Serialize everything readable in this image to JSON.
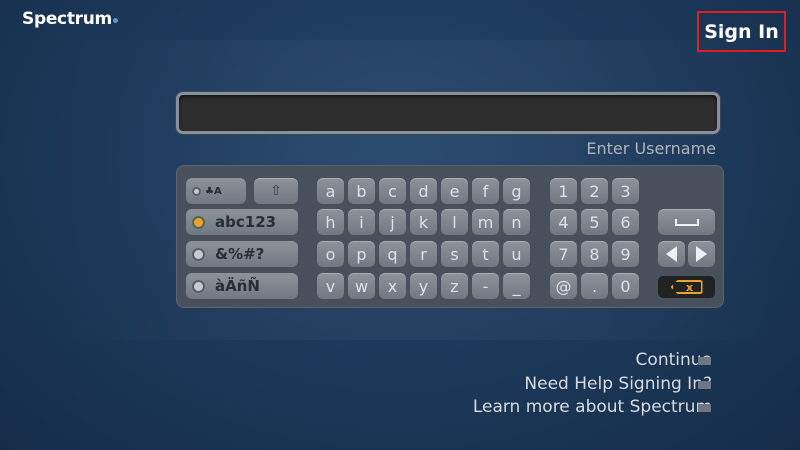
{
  "header": {
    "brand": "Spectrum",
    "signin_label": "Sign In"
  },
  "form": {
    "username_value": "",
    "username_label": "Enter Username"
  },
  "keyboard": {
    "modes": [
      {
        "label": "♣A",
        "selected": false
      },
      {
        "label": "abc123",
        "selected": true
      },
      {
        "label": "&%#?",
        "selected": false
      },
      {
        "label": "àÄñÑ",
        "selected": false
      }
    ],
    "shift_label": "⇧",
    "letter_rows": [
      [
        "a",
        "b",
        "c",
        "d",
        "e",
        "f",
        "g"
      ],
      [
        "h",
        "i",
        "j",
        "k",
        "l",
        "m",
        "n"
      ],
      [
        "o",
        "p",
        "q",
        "r",
        "s",
        "t",
        "u"
      ],
      [
        "v",
        "w",
        "x",
        "y",
        "z",
        "-",
        "_"
      ]
    ],
    "number_rows": [
      [
        "1",
        "2",
        "3"
      ],
      [
        "4",
        "5",
        "6"
      ],
      [
        "7",
        "8",
        "9"
      ],
      [
        "@",
        ".",
        "0"
      ]
    ],
    "backspace_label": "x"
  },
  "menu": {
    "items": [
      "Continue",
      "Need Help Signing In?",
      "Learn more about Spectrum"
    ]
  },
  "colors": {
    "accent": "#e9a620",
    "highlight": "#e21d1d",
    "background": "#1d3a5c"
  }
}
